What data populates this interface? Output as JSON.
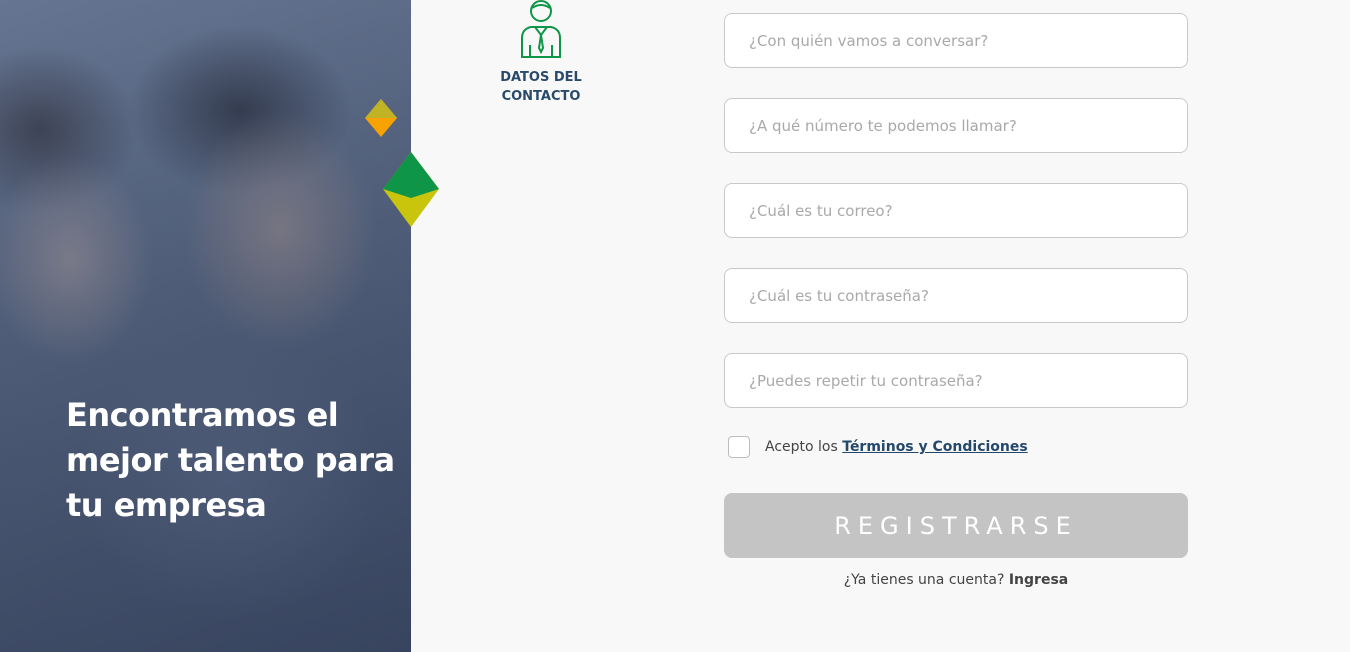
{
  "hero": {
    "headline": "Encontramos el mejor talento para tu empresa"
  },
  "step": {
    "icon": "person-tie-icon",
    "label_line1": "DATOS DEL",
    "label_line2": "CONTACTO"
  },
  "form": {
    "name_placeholder": "¿Con quién vamos a conversar?",
    "phone_placeholder": "¿A qué número te podemos llamar?",
    "email_placeholder": "¿Cuál es tu correo?",
    "password_placeholder": "¿Cuál es tu contraseña?",
    "repeat_password_placeholder": "¿Puedes repetir tu contraseña?",
    "terms_prefix": "Acepto los",
    "terms_link": "Términos y Condiciones",
    "submit_label": "REGISTRARSE",
    "login_prompt": "¿Ya tienes una cuenta?",
    "login_link": "Ingresa"
  },
  "colors": {
    "brand_green": "#0f9547",
    "brand_yellow": "#c9c40c",
    "brand_orange": "#f8a200",
    "brand_navy": "#24476c",
    "button_disabled": "#c4c4c4"
  }
}
